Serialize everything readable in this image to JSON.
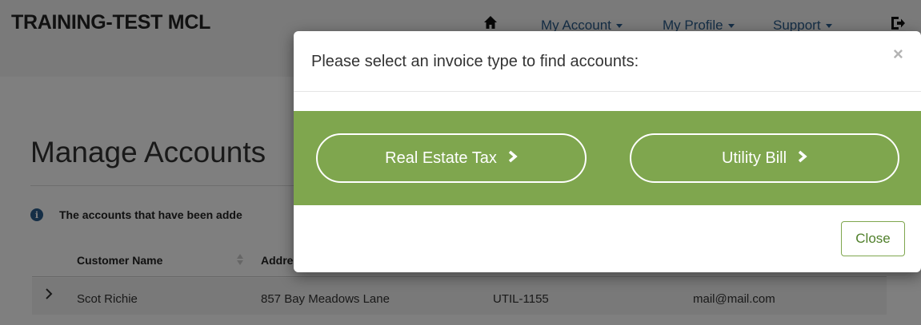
{
  "header": {
    "brand": "TRAINING-TEST MCL",
    "nav": {
      "my_account": "My Account",
      "my_profile": "My Profile",
      "support": "Support"
    }
  },
  "page": {
    "title": "Manage Accounts",
    "info_text": "The accounts that have been adde",
    "table": {
      "columns": [
        "Customer Name",
        "Addre"
      ],
      "rows": [
        {
          "name": "Scot Richie",
          "address": "857 Bay Meadows Lane",
          "account": "UTIL-1155",
          "email": "mail@mail.com"
        }
      ]
    }
  },
  "modal": {
    "title": "Please select an invoice type to find accounts:",
    "close_x": "×",
    "options": [
      "Real Estate Tax",
      "Utility Bill"
    ],
    "close_button": "Close"
  },
  "colors": {
    "accent_green": "#7fa64e",
    "link_blue": "#2a5d8c"
  }
}
